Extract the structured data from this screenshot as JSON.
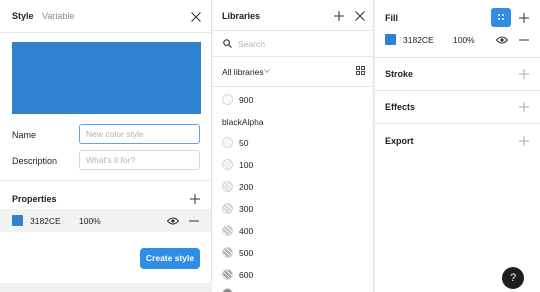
{
  "style_panel": {
    "tab_active": "Style",
    "tab_inactive": "Variable",
    "preview_color": "#3182CE",
    "name_label": "Name",
    "name_placeholder": "New color style",
    "description_label": "Description",
    "description_placeholder": "What's it for?",
    "properties_title": "Properties",
    "property_row": {
      "hex": "3182CE",
      "opacity": "100%",
      "color": "#3182CE"
    },
    "create_button": "Create style"
  },
  "libraries_panel": {
    "title": "Libraries",
    "search_placeholder": "Search",
    "filter_label": "All libraries",
    "items_top": [
      {
        "label": "900",
        "color": "#fafafa"
      }
    ],
    "group_label": "blackAlpha",
    "group_items": [
      {
        "label": "50",
        "color": "#f4f4f4"
      },
      {
        "label": "100",
        "color": "#ececec"
      },
      {
        "label": "200",
        "color": "#e2e2e2"
      },
      {
        "label": "300",
        "color": "#d6d6d6"
      },
      {
        "label": "400",
        "color": "#c6c6c6"
      },
      {
        "label": "500",
        "color": "#b3b3b3"
      },
      {
        "label": "600",
        "color": "#9f9f9f"
      }
    ]
  },
  "properties_panel": {
    "fill_title": "Fill",
    "fill_row": {
      "hex": "3182CE",
      "opacity": "100%",
      "color": "#3182CE"
    },
    "stroke_title": "Stroke",
    "effects_title": "Effects",
    "export_title": "Export",
    "help_label": "?"
  },
  "colors": {
    "accent": "#2F8DE4",
    "focus_border": "#5DA4E5",
    "row_highlight": "#F2F2F2"
  }
}
